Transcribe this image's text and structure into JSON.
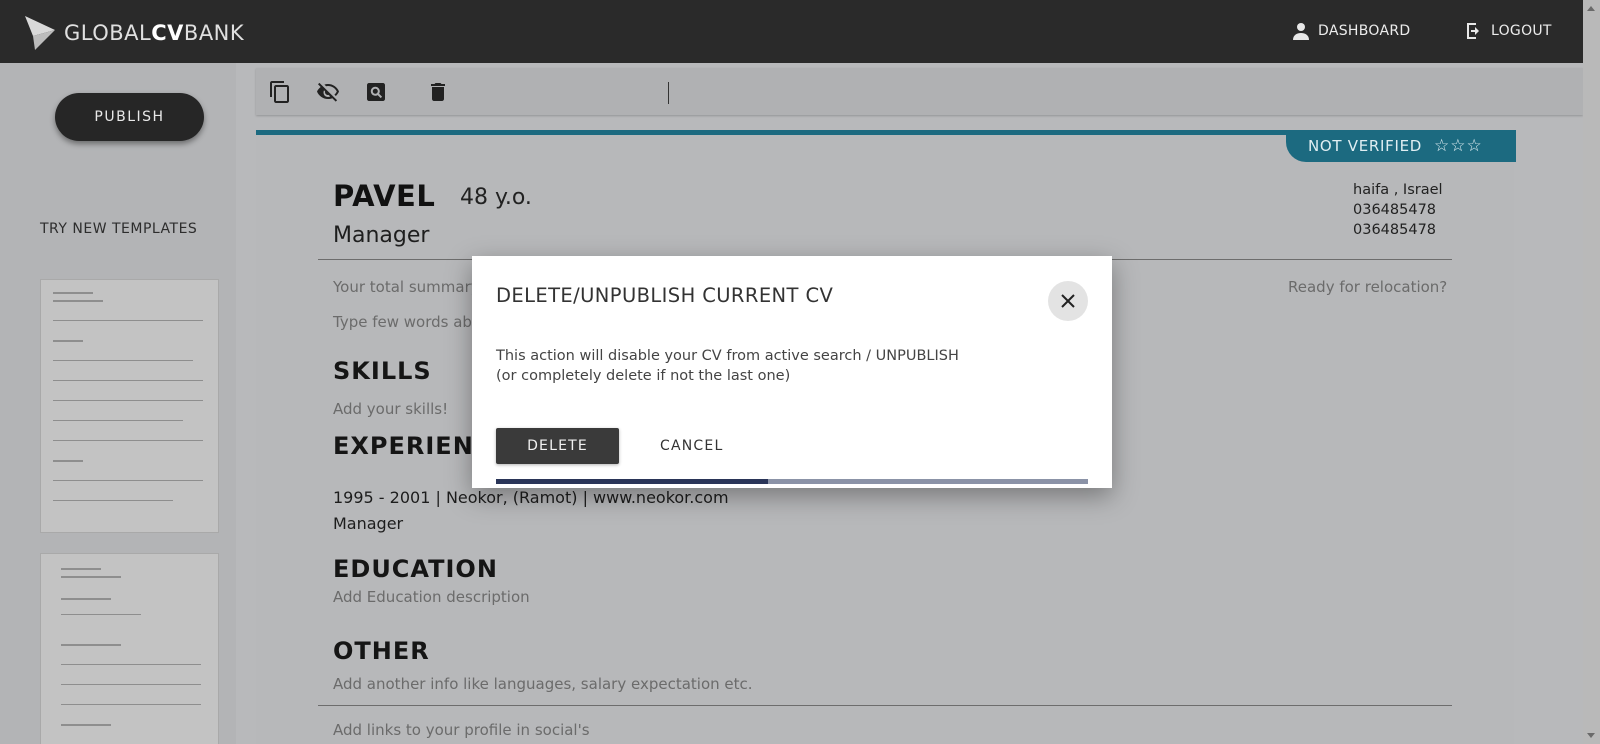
{
  "header": {
    "logo_light1": "GLOBAL",
    "logo_bold": "CV",
    "logo_light2": "BANK",
    "dashboard_label": "DASHBOARD",
    "logout_label": "LOGOUT"
  },
  "sidebar": {
    "publish_label": "PUBLISH",
    "try_templates_label": "TRY NEW TEMPLATES"
  },
  "toolbar": {
    "icons": [
      "copy-icon",
      "eye-off-icon",
      "search-icon",
      "trash-icon"
    ]
  },
  "cv": {
    "verification_status": "NOT VERIFIED",
    "stars": "☆☆☆",
    "name": "PAVEL",
    "age": "48 y.o.",
    "title": "Manager",
    "contact": {
      "location": "haifa , Israel",
      "phone1": "036485478",
      "phone2": "036485478"
    },
    "summary_placeholder": "Your total summary",
    "relocation_placeholder": "Ready for relocation?",
    "summary_desc_placeholder": "Type few words abo",
    "skills_heading": "SKILLS",
    "skills_placeholder": "Add your skills!",
    "experience_heading": "EXPERIENC",
    "experience_entry": "1995 - 2001 | Neokor, (Ramot) | www.neokor.com",
    "experience_role": "Manager",
    "education_heading": "EDUCATION",
    "education_placeholder": "Add Education description",
    "other_heading": "OTHER",
    "other_placeholder": "Add another info like languages, salary expectation etc.",
    "links_placeholder": "Add links to your profile in social's"
  },
  "modal": {
    "title": "DELETE/UNPUBLISH CURRENT CV",
    "body_line1": "This action will disable your CV from active search / UNPUBLISH",
    "body_line2": "(or completely delete if not the last one)",
    "delete_label": "DELETE",
    "cancel_label": "CANCEL",
    "progress_fraction": 0.46
  },
  "colors": {
    "header_bg": "#2a2a2a",
    "accent_teal": "#1c6a80",
    "progress_fill": "#2a3558",
    "progress_track": "#8b93a7"
  }
}
